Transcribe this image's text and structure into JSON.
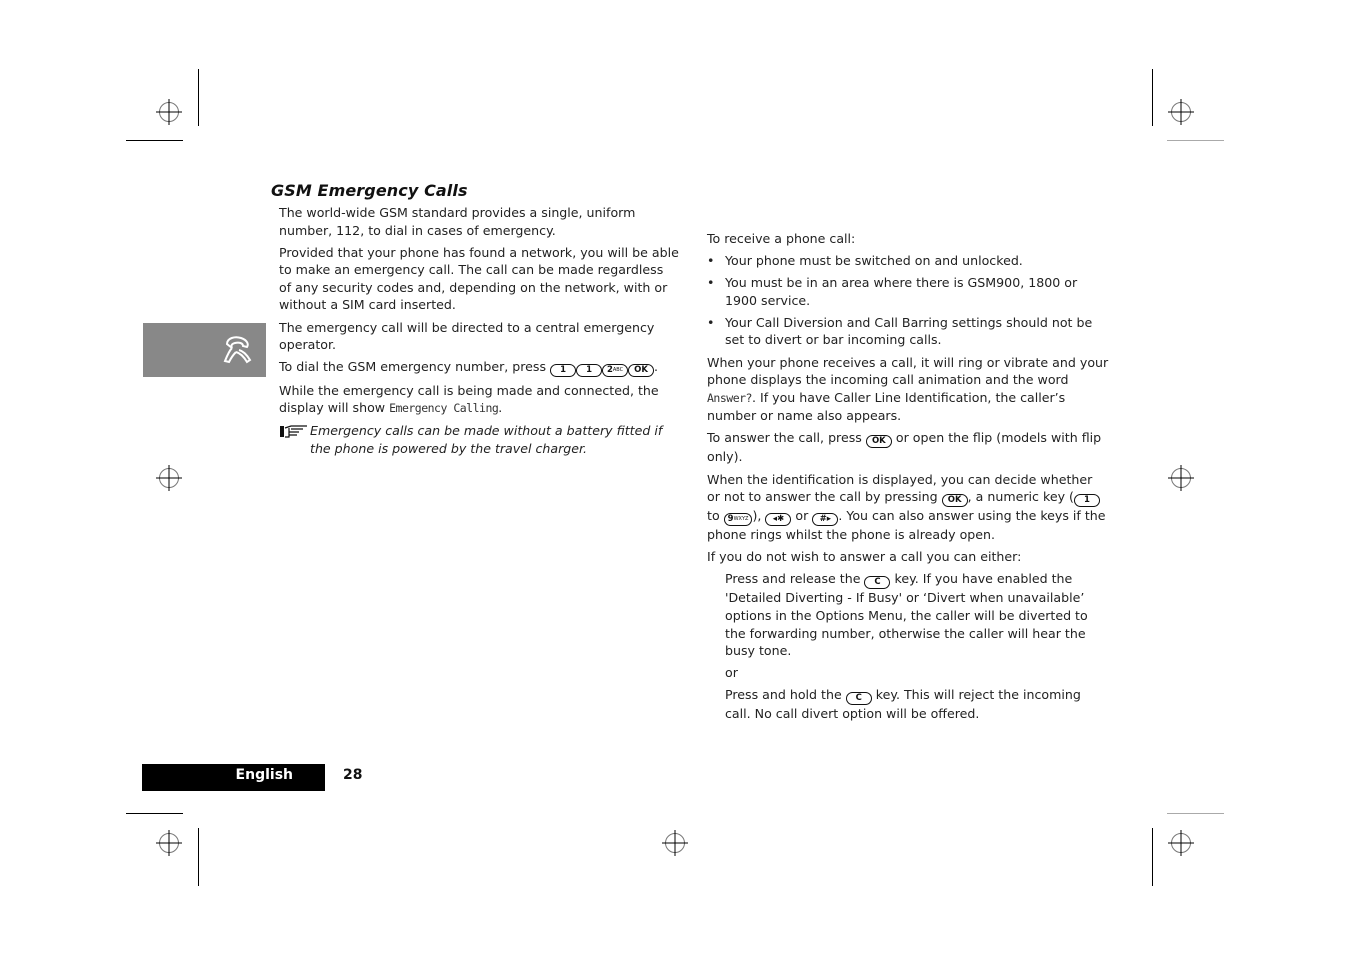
{
  "section": {
    "title": "GSM Emergency Calls",
    "icon": "emergency-phone-icon",
    "sidebox_color": "#888888"
  },
  "left_column": {
    "p1": "The world-wide GSM standard provides a single, uniform number, 112, to dial in cases of emergency.",
    "p2": "Provided that your phone has found a network, you will be able to make an emergency call. The call can be made regardless of any security codes and, depending on the network, with or without a SIM card inserted.",
    "p3": "The emergency call will be directed to a central emergency operator.",
    "p4_prefix": "To dial the GSM emergency number, press",
    "p4_keys": [
      "1",
      "1",
      "2",
      "OK"
    ],
    "p4_key2_letters": "ABC",
    "p4_suffix": ".",
    "p5_prefix": "While the emergency call is being made and connected, the display will show",
    "p5_display": "Emergency Calling",
    "p5_suffix": ".",
    "note": "Emergency calls can be made without a battery fitted if the phone is powered by the travel charger."
  },
  "right_column": {
    "intro": "To receive a phone call:",
    "bullets": [
      "Your phone must be switched on and unlocked.",
      "You must be in an area where there is GSM900, 1800 or 1900 service.",
      "Your Call Diversion and Call Barring settings should not be set to divert or bar incoming calls."
    ],
    "p1_prefix": "When your phone receives a call, it will ring or vibrate and your phone displays the incoming call animation and the word",
    "p1_display": "Answer?",
    "p1_suffix": ". If you have Caller Line Identification, the caller’s number or name also appears.",
    "p2_prefix": "To answer the call, press",
    "p2_key": "OK",
    "p2_suffix": "or open the flip (models with flip only).",
    "p3_a": "When the identification is displayed, you can decide whether or not to answer the call by pressing",
    "p3_key_ok": "OK",
    "p3_b": ", a numeric key (",
    "p3_key_1": "1",
    "p3_c": "to",
    "p3_key_9": "9",
    "p3_key_9_letters": "WXYZ",
    "p3_d": "),",
    "p3_key_star": "◂✱",
    "p3_e": "or",
    "p3_key_hash": "#▸",
    "p3_f": ". You can also answer using the keys if the phone rings whilst the phone is already open.",
    "p4": "If you do not wish to answer a call you can either:",
    "opt1_prefix": "Press and release the",
    "opt1_key": "C",
    "opt1_suffix": "key. If you have enabled the 'Detailed Diverting - If Busy' or ‘Divert when unavailable’ options in the Options Menu, the caller will be diverted to the forwarding number, otherwise the caller will hear the busy tone.",
    "or": "or",
    "opt2_prefix": "Press and hold the",
    "opt2_key": "C",
    "opt2_suffix": "key. This will reject the incoming call. No call divert option will be offered."
  },
  "footer": {
    "language": "English",
    "page_number": "28"
  }
}
